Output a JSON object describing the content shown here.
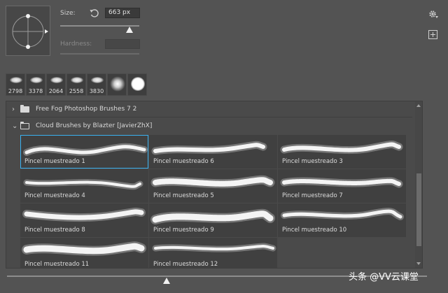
{
  "settings": {
    "size_label": "Size:",
    "size_value": "663 px",
    "size_level": 0.88,
    "hardness_label": "Hardness:",
    "hardness_value": ""
  },
  "icons": {
    "reset": "reset-icon",
    "gear": "gear-icon",
    "new_preset": "new-preset-icon",
    "folder": "folder-icon",
    "chevron_right": "chevron-right-icon",
    "chevron_down": "chevron-down-icon"
  },
  "recent_brushes": [
    {
      "label": "2798",
      "kind": "cloud"
    },
    {
      "label": "3378",
      "kind": "cloud"
    },
    {
      "label": "2064",
      "kind": "cloud"
    },
    {
      "label": "2558",
      "kind": "cloud"
    },
    {
      "label": "3830",
      "kind": "cloud"
    },
    {
      "label": "",
      "kind": "soft"
    },
    {
      "label": "",
      "kind": "hard"
    }
  ],
  "groups": [
    {
      "label": "Free Fog Photoshop Brushes 7 2",
      "expanded": false
    },
    {
      "label": "Cloud Brushes by Blazter [JavierZhX]",
      "expanded": true
    }
  ],
  "brushes": [
    {
      "label": "Pincel muestreado 1",
      "selected": true
    },
    {
      "label": "Pincel muestreado 6",
      "selected": false
    },
    {
      "label": "Pincel muestreado 3",
      "selected": false
    },
    {
      "label": "Pincel muestreado 4",
      "selected": false
    },
    {
      "label": "Pincel muestreado 5",
      "selected": false
    },
    {
      "label": "Pincel muestreado 7",
      "selected": false
    },
    {
      "label": "Pincel muestreado 8",
      "selected": false
    },
    {
      "label": "Pincel muestreado 9",
      "selected": false
    },
    {
      "label": "Pincel muestreado 10",
      "selected": false
    },
    {
      "label": "Pincel muestreado 11",
      "selected": false
    },
    {
      "label": "Pincel muestreado 12",
      "selected": false
    }
  ],
  "colors": {
    "selection": "#3ab1f0",
    "panel": "#535353"
  },
  "watermark": "头条 @VV云课堂"
}
